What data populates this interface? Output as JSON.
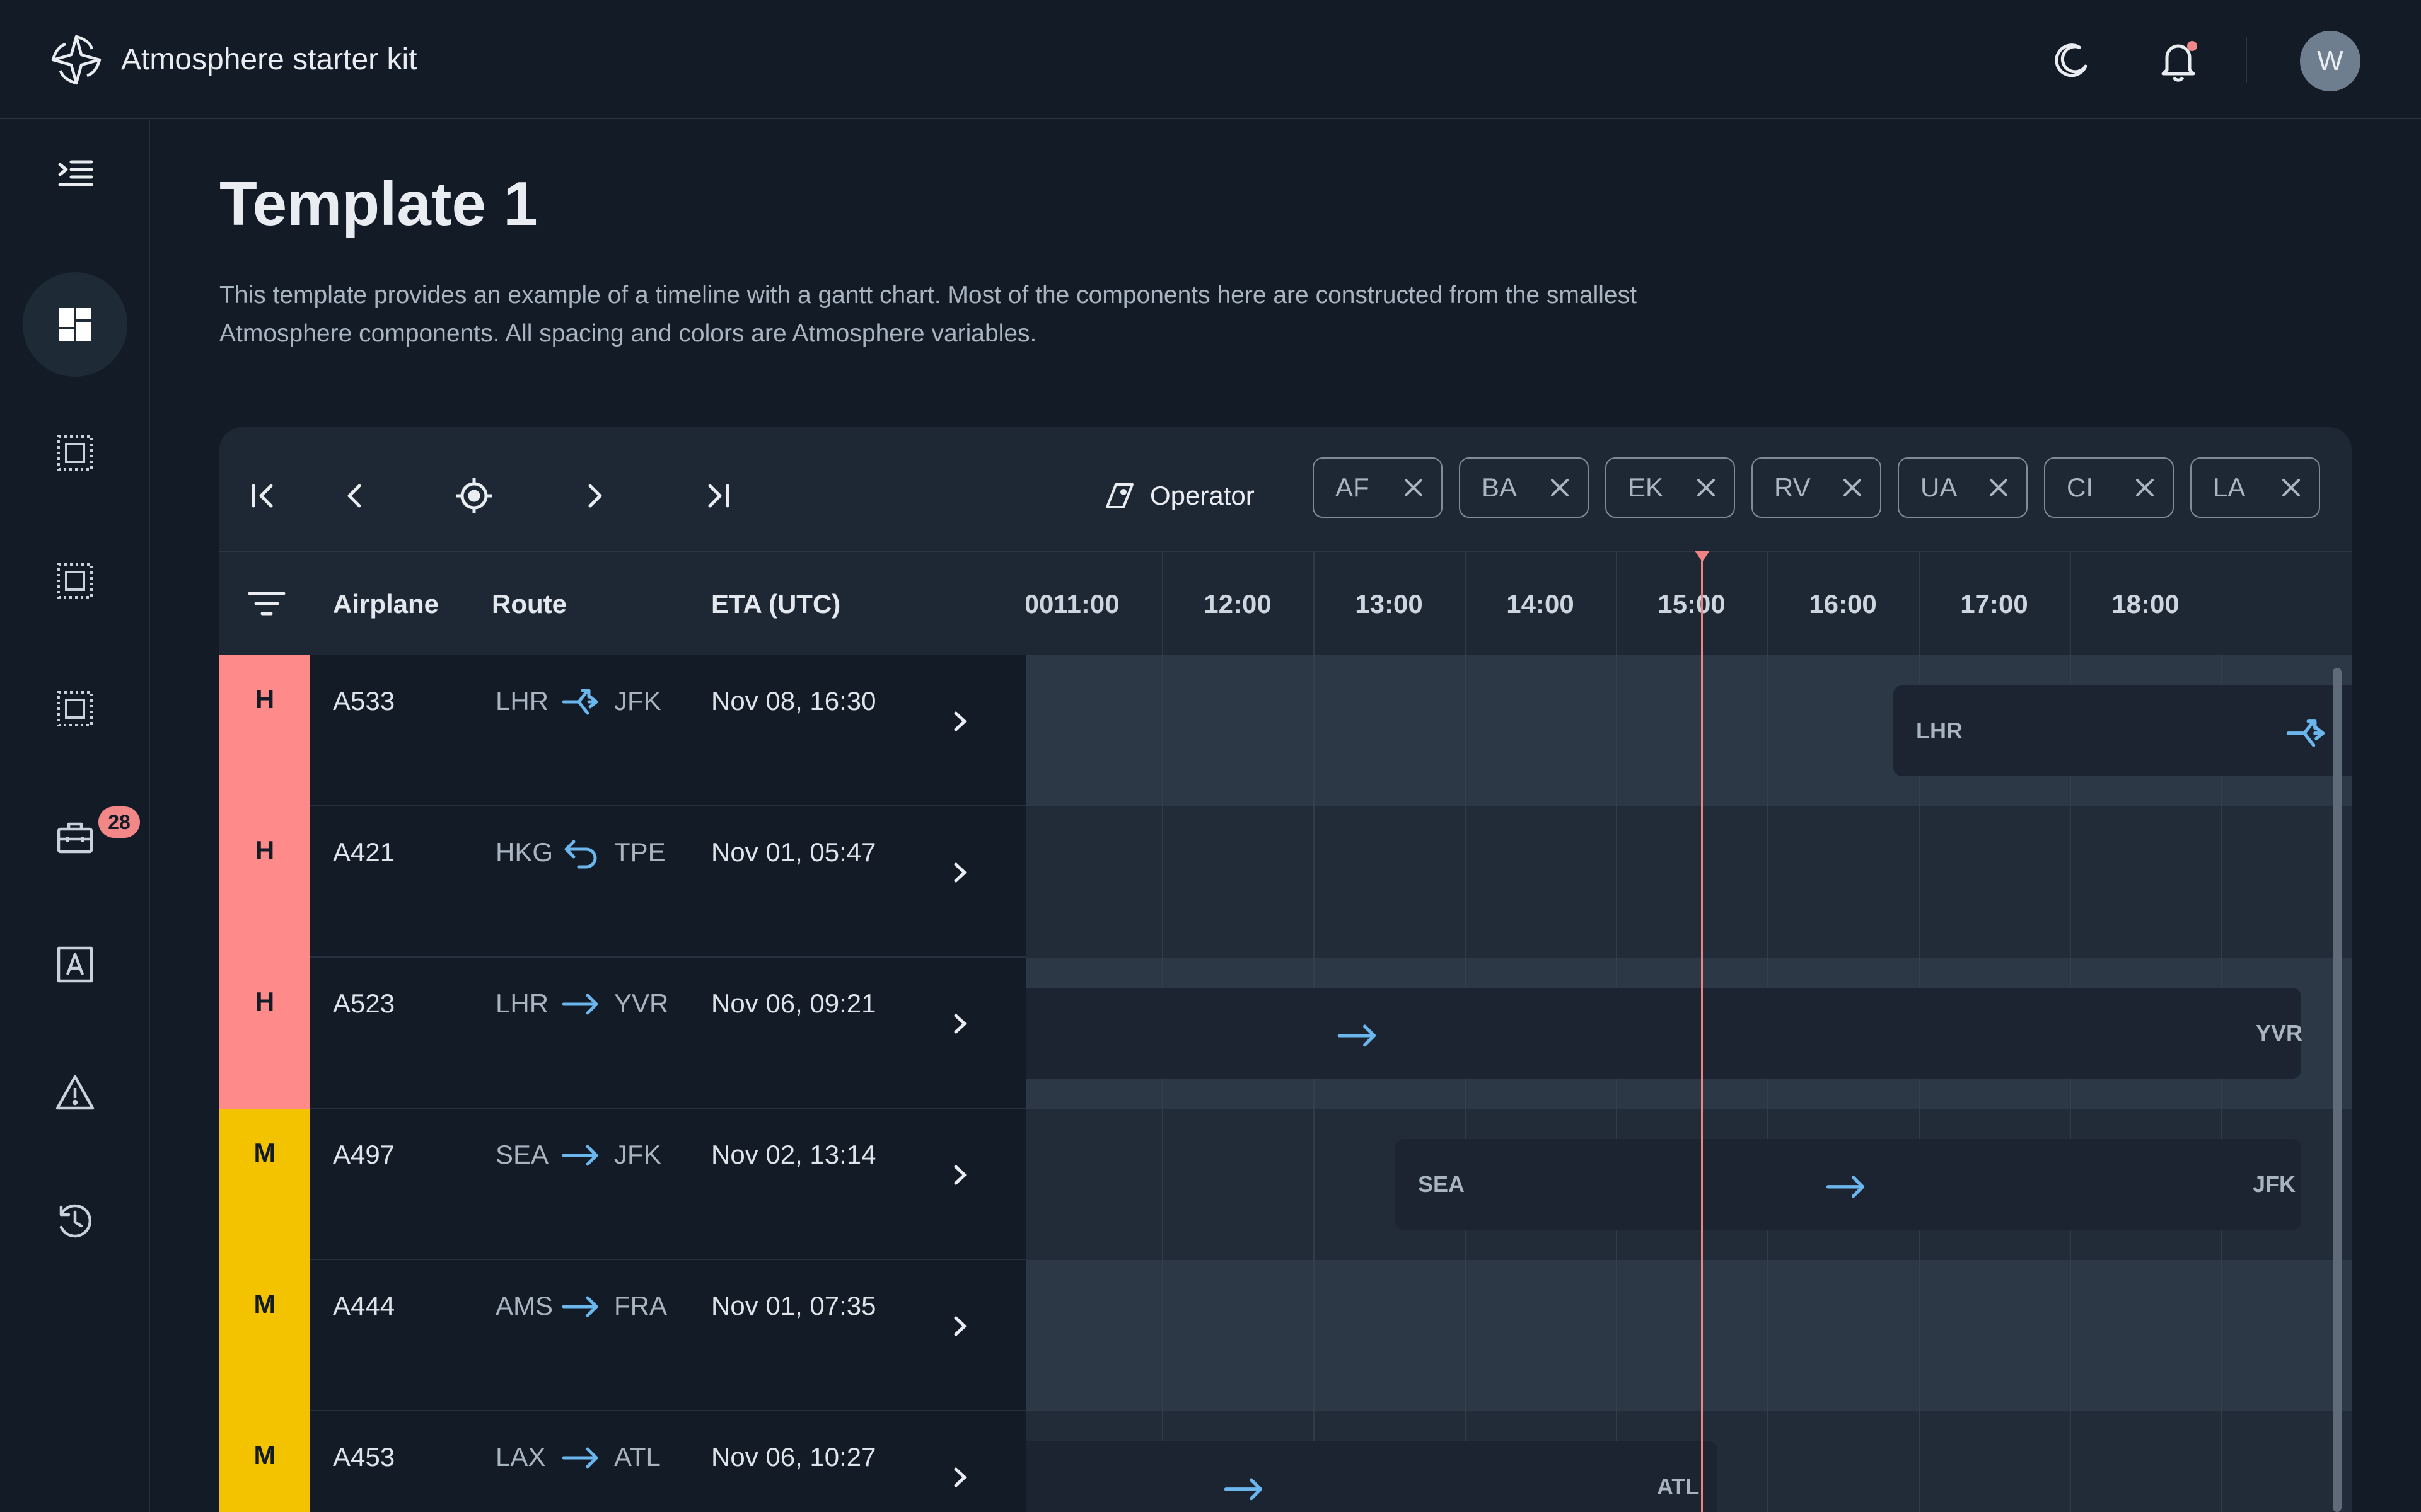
{
  "app": {
    "title": "Atmosphere starter kit",
    "avatar_initial": "W"
  },
  "header": {
    "icons": [
      "logo-icon",
      "moon-icon",
      "bell-icon"
    ],
    "notification_dot_color": "#f28788"
  },
  "sidebar": {
    "items": [
      {
        "name": "collapse",
        "icon": "menu-collapse-icon"
      },
      {
        "name": "dashboard",
        "icon": "dashboard-icon",
        "active": true
      },
      {
        "name": "template-2",
        "icon": "template-icon"
      },
      {
        "name": "template-3",
        "icon": "template-icon"
      },
      {
        "name": "template-4",
        "icon": "template-icon"
      },
      {
        "name": "toolbox",
        "icon": "toolbox-icon",
        "badge": "28"
      },
      {
        "name": "text",
        "icon": "text-box-icon"
      },
      {
        "name": "alerts",
        "icon": "warning-icon"
      },
      {
        "name": "history",
        "icon": "history-icon"
      }
    ]
  },
  "page": {
    "title": "Template 1",
    "description": "This template provides an example of a timeline with a gantt chart. Most of the components here are constructed from the smallest Atmosphere components. All spacing and colors are Atmosphere variables."
  },
  "toolbar": {
    "buttons": [
      "first-page-icon",
      "previous-icon",
      "locate-icon",
      "next-icon",
      "last-page-icon"
    ],
    "operator_label": "Operator",
    "chips": [
      "AF",
      "BA",
      "EK",
      "RV",
      "UA",
      "CI",
      "LA"
    ]
  },
  "table": {
    "columns": {
      "airplane": "Airplane",
      "route": "Route",
      "eta": "ETA (UTC)"
    },
    "rows": [
      {
        "priority": "H",
        "airplane": "A533",
        "from": "LHR",
        "to": "JFK",
        "route_icon": "diversion-icon",
        "eta": "Nov 08, 16:30"
      },
      {
        "priority": "H",
        "airplane": "A421",
        "from": "HKG",
        "to": "TPE",
        "route_icon": "return-icon",
        "eta": "Nov 01, 05:47"
      },
      {
        "priority": "H",
        "airplane": "A523",
        "from": "LHR",
        "to": "YVR",
        "route_icon": "arrow-right-icon",
        "eta": "Nov 06, 09:21"
      },
      {
        "priority": "M",
        "airplane": "A497",
        "from": "SEA",
        "to": "JFK",
        "route_icon": "arrow-right-icon",
        "eta": "Nov 02, 13:14"
      },
      {
        "priority": "M",
        "airplane": "A444",
        "from": "AMS",
        "to": "FRA",
        "route_icon": "arrow-right-icon",
        "eta": "Nov 01, 07:35"
      },
      {
        "priority": "M",
        "airplane": "A453",
        "from": "LAX",
        "to": "ATL",
        "route_icon": "arrow-right-icon",
        "eta": "Nov 06, 10:27"
      }
    ]
  },
  "priority_colors": {
    "H": "#ff8a8a",
    "M": "#f3c300"
  },
  "timeline": {
    "partial_left_label": "00",
    "hours": [
      "11:00",
      "12:00",
      "13:00",
      "14:00",
      "15:00",
      "16:00",
      "17:00",
      "18:00"
    ],
    "now_color": "#ef8283",
    "bars": [
      {
        "row": 0,
        "start_label": "LHR",
        "end_label": "",
        "icon": "diversion-icon"
      },
      {
        "row": 2,
        "start_label": "",
        "end_label": "YVR",
        "icon": "arrow-right-icon"
      },
      {
        "row": 3,
        "start_label": "SEA",
        "end_label": "JFK",
        "icon": "arrow-right-icon"
      },
      {
        "row": 5,
        "start_label": "",
        "end_label": "ATL",
        "icon": "arrow-right-icon"
      }
    ]
  }
}
